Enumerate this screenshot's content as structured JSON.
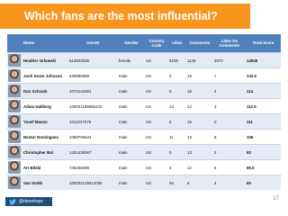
{
  "title": "Which fans are the most influential?",
  "columns": {
    "name": "Name",
    "user_id": "UserID",
    "gender": "Gender",
    "country_code": "Country Code",
    "likes": "Likes",
    "comments": "Comments",
    "likes_on_comments": "Likes On Comments",
    "total_score": "Total Score"
  },
  "rows": [
    {
      "name": "Heather Orlowski",
      "user_id": "613943336",
      "gender": "female",
      "country": "US",
      "likes": "5108",
      "comments": "1128",
      "likes_on_comments": "2072",
      "total": "14940"
    },
    {
      "name": "Josh Dozer Johnson",
      "user_id": "639990589",
      "gender": "male",
      "country": "US",
      "likes": "3",
      "comments": "18",
      "likes_on_comments": "7",
      "total": "132.5"
    },
    {
      "name": "Dan Schrack",
      "user_id": "1073142591",
      "gender": "male",
      "country": "US",
      "likes": "0",
      "comments": "16",
      "likes_on_comments": "4",
      "total": "114"
    },
    {
      "name": "Adam Hallberg",
      "user_id": "100001188985232",
      "gender": "male",
      "country": "US",
      "likes": "13",
      "comments": "14",
      "likes_on_comments": "3",
      "total": "112.5"
    },
    {
      "name": "Yusef Mason",
      "user_id": "1011237079",
      "gender": "male",
      "country": "US",
      "likes": "6",
      "comments": "15",
      "likes_on_comments": "0",
      "total": "111"
    },
    {
      "name": "Nestor Dominguez",
      "user_id": "1068706644",
      "gender": "male",
      "country": "US",
      "likes": "11",
      "comments": "13",
      "likes_on_comments": "8",
      "total": "106"
    },
    {
      "name": "Christopher Bal",
      "user_id": "1431438067",
      "gender": "male",
      "country": "US",
      "likes": "0",
      "comments": "13",
      "likes_on_comments": "2",
      "total": "92"
    },
    {
      "name": "Art Bilski",
      "user_id": "740266266",
      "gender": "male",
      "country": "US",
      "likes": "4",
      "comments": "12",
      "likes_on_comments": "5",
      "total": "90.5"
    },
    {
      "name": "Van Smith",
      "user_id": "100004125512005",
      "gender": "male",
      "country": "US",
      "likes": "46",
      "comments": "6",
      "likes_on_comments": "4",
      "total": "90"
    }
  ],
  "footer": {
    "handle": "@dennitops",
    "page_number": "17"
  },
  "colors": {
    "title_bar": "#f7951d",
    "header": "#4f81bd",
    "row_alt": "#e4ebf5",
    "handle_bar": "#1f4e79"
  }
}
